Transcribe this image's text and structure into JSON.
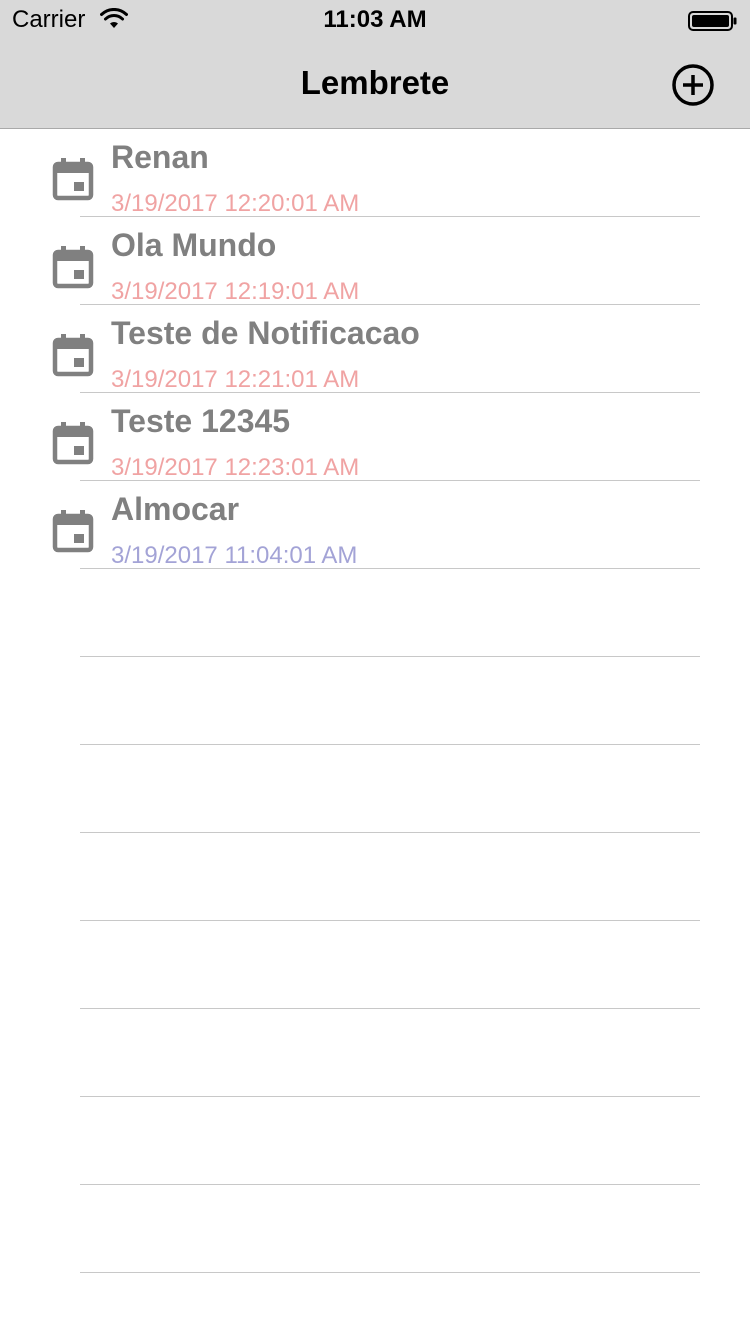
{
  "status_bar": {
    "carrier": "Carrier",
    "time": "11:03 AM"
  },
  "nav": {
    "title": "Lembrete",
    "add_icon": "plus-circle-icon"
  },
  "colors": {
    "past_date": "#f0a3a3",
    "future_date": "#a3a3d6",
    "title_text": "#808080",
    "icon": "#808080"
  },
  "reminders": [
    {
      "title": "Renan",
      "date": "3/19/2017 12:20:01 AM",
      "status": "past"
    },
    {
      "title": "Ola Mundo",
      "date": "3/19/2017 12:19:01 AM",
      "status": "past"
    },
    {
      "title": "Teste de Notificacao",
      "date": "3/19/2017 12:21:01 AM",
      "status": "past"
    },
    {
      "title": "Teste 12345",
      "date": "3/19/2017 12:23:01 AM",
      "status": "past"
    },
    {
      "title": "Almocar",
      "date": "3/19/2017 11:04:01 AM",
      "status": "future"
    }
  ]
}
